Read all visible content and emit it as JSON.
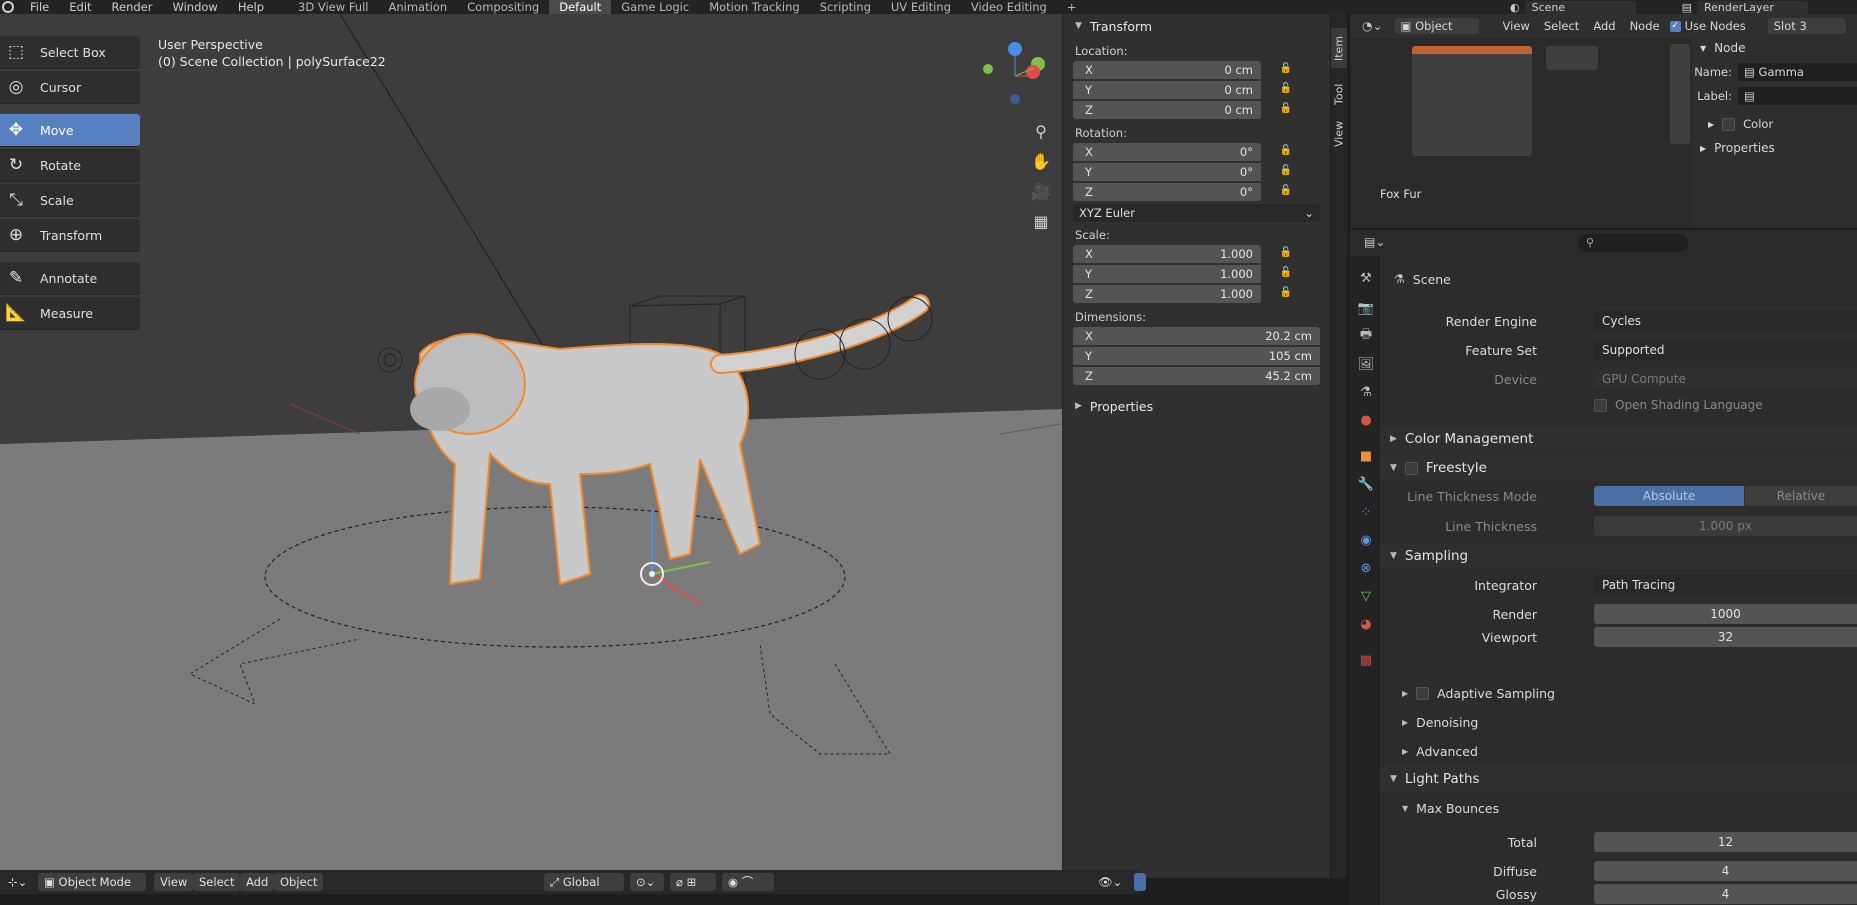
{
  "topbar": {
    "menu": [
      "File",
      "Edit",
      "Render",
      "Window",
      "Help"
    ],
    "workspaces": [
      "3D View Full",
      "Animation",
      "Compositing",
      "Default",
      "Game Logic",
      "Motion Tracking",
      "Scripting",
      "UV Editing",
      "Video Editing"
    ],
    "active_workspace": "Default",
    "add_label": "+",
    "scene": "Scene",
    "render_layer": "RenderLayer"
  },
  "viewport": {
    "perspective": "User Perspective",
    "collection": "(0) Scene Collection | polySurface22",
    "tools": [
      {
        "label": "Select Box",
        "icon": "select-box-icon"
      },
      {
        "label": "Cursor",
        "icon": "cursor-icon"
      },
      {
        "label": "Move",
        "icon": "move-icon"
      },
      {
        "label": "Rotate",
        "icon": "rotate-icon"
      },
      {
        "label": "Scale",
        "icon": "scale-icon"
      },
      {
        "label": "Transform",
        "icon": "transform-icon"
      },
      {
        "label": "Annotate",
        "icon": "annotate-icon"
      },
      {
        "label": "Measure",
        "icon": "measure-icon"
      }
    ],
    "active_tool": "Move",
    "gizmo": {
      "x": "X",
      "y": "Y",
      "z": "Z"
    }
  },
  "vpheader": {
    "mode": "Object Mode",
    "menus": [
      "View",
      "Select",
      "Add",
      "Object"
    ],
    "orientation": "Global"
  },
  "npanel": {
    "title": "Transform",
    "location_label": "Location:",
    "location": [
      {
        "axis": "X",
        "value": "0 cm"
      },
      {
        "axis": "Y",
        "value": "0 cm"
      },
      {
        "axis": "Z",
        "value": "0 cm"
      }
    ],
    "rotation_label": "Rotation:",
    "rotation": [
      {
        "axis": "X",
        "value": "0°"
      },
      {
        "axis": "Y",
        "value": "0°"
      },
      {
        "axis": "Z",
        "value": "0°"
      }
    ],
    "rotation_mode": "XYZ Euler",
    "scale_label": "Scale:",
    "scale": [
      {
        "axis": "X",
        "value": "1.000"
      },
      {
        "axis": "Y",
        "value": "1.000"
      },
      {
        "axis": "Z",
        "value": "1.000"
      }
    ],
    "dimensions_label": "Dimensions:",
    "dimensions": [
      {
        "axis": "X",
        "value": "20.2 cm"
      },
      {
        "axis": "Y",
        "value": "105 cm"
      },
      {
        "axis": "Z",
        "value": "45.2 cm"
      }
    ],
    "properties": "Properties",
    "tabs": [
      "Item",
      "Tool",
      "View"
    ]
  },
  "node_editor": {
    "type": "Object",
    "menus": [
      "View",
      "Select",
      "Add",
      "Node"
    ],
    "use_nodes": "Use Nodes",
    "slot": "Slot 3",
    "material_label": "Fox Fur",
    "side": {
      "title": "Node",
      "name_label": "Name:",
      "name_value": "Gamma",
      "label_label": "Label:",
      "color": "Color",
      "properties": "Properties"
    }
  },
  "properties": {
    "scene": "Scene",
    "render_engine_label": "Render Engine",
    "render_engine": "Cycles",
    "feature_set_label": "Feature Set",
    "feature_set": "Supported",
    "device_label": "Device",
    "device": "GPU Compute",
    "osl": "Open Shading Language",
    "color_management": "Color Management",
    "freestyle": "Freestyle",
    "line_thickness_mode_label": "Line Thickness Mode",
    "absolute": "Absolute",
    "relative": "Relative",
    "line_thickness_label": "Line Thickness",
    "line_thickness": "1.000 px",
    "sampling": "Sampling",
    "integrator_label": "Integrator",
    "integrator": "Path Tracing",
    "render_label": "Render",
    "render": "1000",
    "viewport_label": "Viewport",
    "viewport": "32",
    "adaptive_sampling": "Adaptive Sampling",
    "denoising": "Denoising",
    "advanced": "Advanced",
    "light_paths": "Light Paths",
    "max_bounces": "Max Bounces",
    "total_label": "Total",
    "total": "12",
    "diffuse_label": "Diffuse",
    "diffuse": "4",
    "glossy_label": "Glossy",
    "glossy": "4"
  },
  "colors": {
    "accent": "#5680c2",
    "selected_outline": "#f08a2a",
    "panel": "#303030"
  }
}
